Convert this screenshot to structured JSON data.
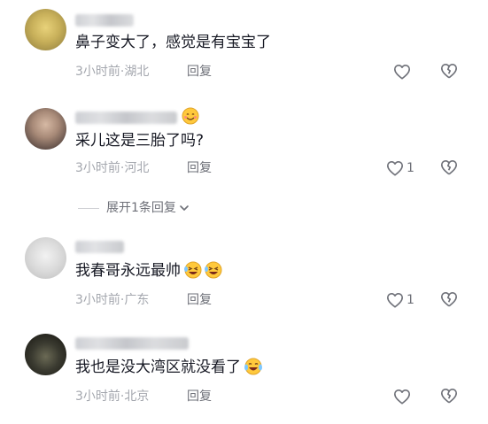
{
  "comments": [
    {
      "text": "鼻子变大了，感觉是有宝宝了",
      "time": "3小时前",
      "location": "湖北",
      "reply_label": "回复",
      "like_count": "",
      "emoji": []
    },
    {
      "text": "采儿这是三胎了吗?",
      "time": "3小时前",
      "location": "河北",
      "reply_label": "回复",
      "like_count": "1",
      "emoji": []
    },
    {
      "text": "我春哥永远最帅",
      "time": "3小时前",
      "location": "广东",
      "reply_label": "回复",
      "like_count": "1",
      "emoji": [
        "grinning-squint-emoji",
        "grinning-squint-emoji"
      ]
    },
    {
      "text": "我也是没大湾区就没看了",
      "time": "3小时前",
      "location": "北京",
      "reply_label": "回复",
      "like_count": "",
      "emoji": [
        "tears-of-joy-emoji"
      ]
    }
  ],
  "expand_replies": {
    "label": "展开1条回复"
  },
  "icons": {
    "like": "heart-outline-icon",
    "dislike": "broken-heart-outline-icon",
    "expand": "chevron-down-icon"
  },
  "colors": {
    "text_primary": "#161823",
    "text_meta": "#a4a7ae",
    "text_secondary": "#6e7078",
    "icon": "#6e7078",
    "emoji_yellow": "#ffc93c"
  }
}
